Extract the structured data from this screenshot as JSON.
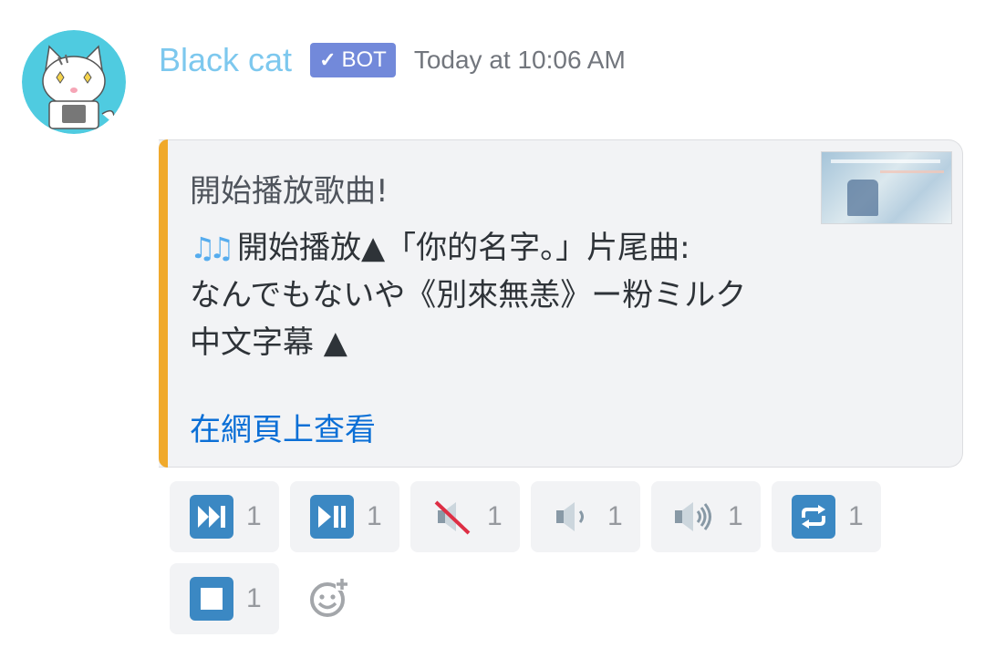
{
  "message": {
    "author": "Black cat",
    "bot_tag": "BOT",
    "bot_check": "✓",
    "timestamp": "Today at 10:06 AM"
  },
  "embed": {
    "accent_color": "#f0a92b",
    "title": "開始播放歌曲!",
    "description_icon": "musical-notes-icon",
    "description_icon_glyph": "♫♫",
    "description_lines": [
      "開始播放▲「你的名字。」片尾曲:",
      "なんでもないや《別來無恙》ー粉ミルク",
      "中文字幕 ▲"
    ],
    "link_text": "在網頁上查看",
    "link_color": "#0b6fd6"
  },
  "reactions": [
    {
      "icon": "next-track-icon",
      "count": "1"
    },
    {
      "icon": "play-pause-icon",
      "count": "1"
    },
    {
      "icon": "muted-speaker-icon",
      "count": "1"
    },
    {
      "icon": "speaker-low-volume-icon",
      "count": "1"
    },
    {
      "icon": "speaker-high-volume-icon",
      "count": "1"
    },
    {
      "icon": "repeat-icon",
      "count": "1"
    },
    {
      "icon": "stop-icon",
      "count": "1"
    }
  ],
  "colors": {
    "username": "#7dc8ee",
    "bot_tag": "#7289da",
    "reaction_button": "#3b88c3",
    "reaction_bg": "#f2f3f5"
  }
}
